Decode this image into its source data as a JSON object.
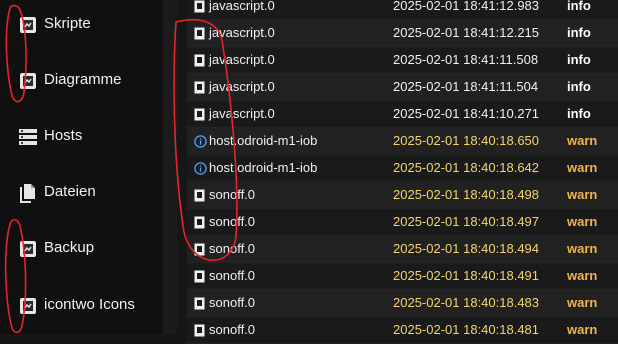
{
  "sidebar": {
    "items": [
      {
        "label": "Skripte",
        "icon": "script-icon"
      },
      {
        "label": "Diagramme",
        "icon": "chart-icon"
      },
      {
        "label": "Hosts",
        "icon": "hosts-icon"
      },
      {
        "label": "Dateien",
        "icon": "files-icon"
      },
      {
        "label": "Backup",
        "icon": "backup-icon"
      },
      {
        "label": "icontwo Icons",
        "icon": "icons-icon"
      }
    ]
  },
  "log": {
    "rows": [
      {
        "source": "javascript.0",
        "time": "2025-02-01 18:41:12.983",
        "level": "info",
        "icon": "adapter-icon"
      },
      {
        "source": "javascript.0",
        "time": "2025-02-01 18:41:12.215",
        "level": "info",
        "icon": "adapter-icon"
      },
      {
        "source": "javascript.0",
        "time": "2025-02-01 18:41:11.508",
        "level": "info",
        "icon": "adapter-icon"
      },
      {
        "source": "javascript.0",
        "time": "2025-02-01 18:41:11.504",
        "level": "info",
        "icon": "adapter-icon"
      },
      {
        "source": "javascript.0",
        "time": "2025-02-01 18:41:10.271",
        "level": "info",
        "icon": "adapter-icon"
      },
      {
        "source": "host.odroid-m1-iob",
        "time": "2025-02-01 18:40:18.650",
        "level": "warn",
        "icon": "info-circle-icon"
      },
      {
        "source": "host.odroid-m1-iob",
        "time": "2025-02-01 18:40:18.642",
        "level": "warn",
        "icon": "info-circle-icon"
      },
      {
        "source": "sonoff.0",
        "time": "2025-02-01 18:40:18.498",
        "level": "warn",
        "icon": "adapter-icon"
      },
      {
        "source": "sonoff.0",
        "time": "2025-02-01 18:40:18.497",
        "level": "warn",
        "icon": "adapter-icon"
      },
      {
        "source": "sonoff.0",
        "time": "2025-02-01 18:40:18.494",
        "level": "warn",
        "icon": "adapter-icon"
      },
      {
        "source": "sonoff.0",
        "time": "2025-02-01 18:40:18.491",
        "level": "warn",
        "icon": "adapter-icon"
      },
      {
        "source": "sonoff.0",
        "time": "2025-02-01 18:40:18.483",
        "level": "warn",
        "icon": "adapter-icon"
      },
      {
        "source": "sonoff.0",
        "time": "2025-02-01 18:40:18.481",
        "level": "warn",
        "icon": "adapter-icon"
      }
    ]
  },
  "colors": {
    "warn_time": "#f2d56c",
    "warn_level": "#f2b34a",
    "annotation": "#e8232a"
  }
}
